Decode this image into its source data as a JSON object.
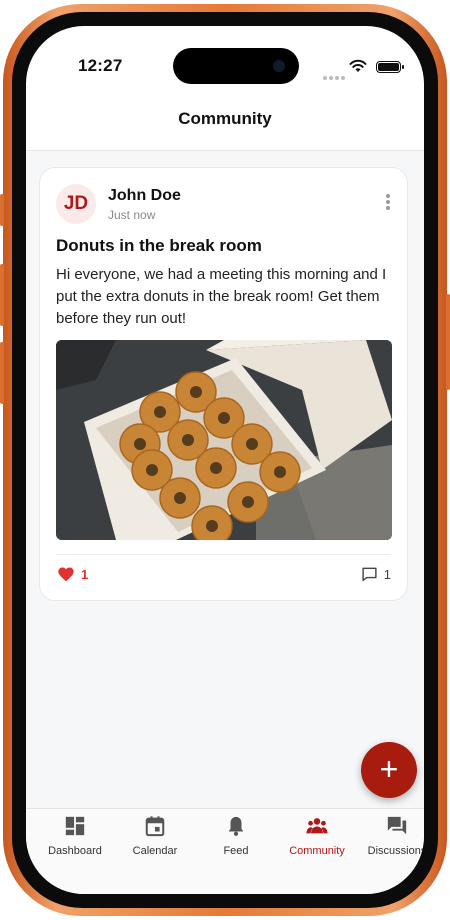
{
  "status": {
    "time": "12:27"
  },
  "header": {
    "title": "Community"
  },
  "post": {
    "avatar_initials": "JD",
    "author": "John Doe",
    "timestamp": "Just now",
    "title": "Donuts in the break room",
    "body": "Hi everyone, we had a meeting this morning and I put the extra donuts in the break room! Get them before they run out!",
    "likes": "1",
    "comments": "1"
  },
  "fab": {
    "label": "+"
  },
  "nav": {
    "tabs": [
      {
        "label": "Dashboard",
        "icon": "dashboard-icon"
      },
      {
        "label": "Calendar",
        "icon": "calendar-icon"
      },
      {
        "label": "Feed",
        "icon": "bell-icon"
      },
      {
        "label": "Community",
        "icon": "people-icon",
        "active": true
      },
      {
        "label": "Discussions",
        "icon": "forum-icon"
      }
    ]
  },
  "colors": {
    "accent": "#b01818",
    "fab": "#a81c10",
    "like": "#e0322f",
    "frame": "#e47a36"
  }
}
